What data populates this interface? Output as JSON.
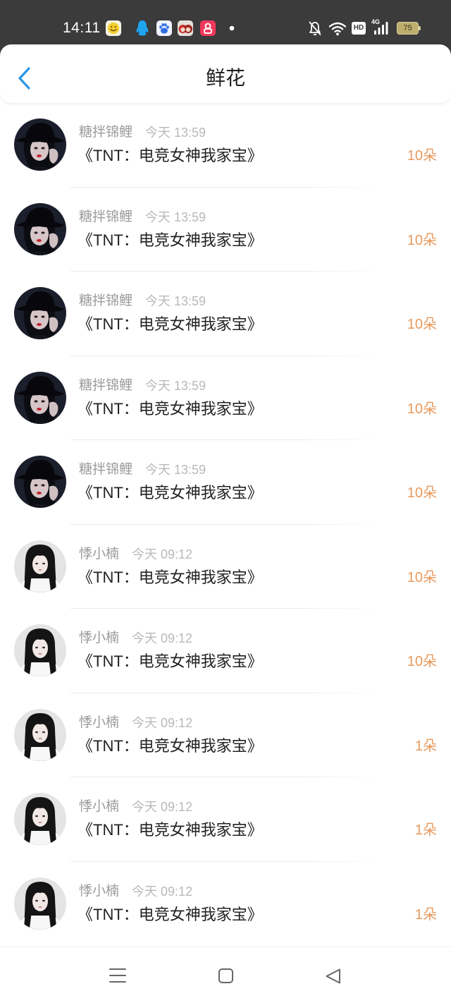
{
  "status_bar": {
    "time": "14:11",
    "hd_label": "HD",
    "network_type": "4G",
    "battery_level": "75",
    "app_icons": [
      "smiley-chat-app-icon",
      "qq-icon",
      "baidu-icon",
      "anime-app-icon",
      "video-app-icon",
      "more-dot-icon"
    ],
    "system_icons": [
      "bell-muted-icon",
      "wifi-icon",
      "hd-icon",
      "signal-icon",
      "battery-icon"
    ]
  },
  "header": {
    "title": "鲜花",
    "back_icon": "chevron-left-icon"
  },
  "flowers": [
    {
      "user": "糖拌锦鲤",
      "time": "今天 13:59",
      "book": "《TNT：电竞女神我家宝》",
      "count": "10朵"
    },
    {
      "user": "糖拌锦鲤",
      "time": "今天 13:59",
      "book": "《TNT：电竞女神我家宝》",
      "count": "10朵"
    },
    {
      "user": "糖拌锦鲤",
      "time": "今天 13:59",
      "book": "《TNT：电竞女神我家宝》",
      "count": "10朵"
    },
    {
      "user": "糖拌锦鲤",
      "time": "今天 13:59",
      "book": "《TNT：电竞女神我家宝》",
      "count": "10朵"
    },
    {
      "user": "糖拌锦鲤",
      "time": "今天 13:59",
      "book": "《TNT：电竞女神我家宝》",
      "count": "10朵"
    },
    {
      "user": "悸小楠",
      "time": "今天 09:12",
      "book": "《TNT：电竞女神我家宝》",
      "count": "10朵"
    },
    {
      "user": "悸小楠",
      "time": "今天 09:12",
      "book": "《TNT：电竞女神我家宝》",
      "count": "10朵"
    },
    {
      "user": "悸小楠",
      "time": "今天 09:12",
      "book": "《TNT：电竞女神我家宝》",
      "count": "1朵"
    },
    {
      "user": "悸小楠",
      "time": "今天 09:12",
      "book": "《TNT：电竞女神我家宝》",
      "count": "1朵"
    },
    {
      "user": "悸小楠",
      "time": "今天 09:12",
      "book": "《TNT：电竞女神我家宝》",
      "count": "1朵"
    }
  ],
  "nav_bar": {
    "icons": [
      "menu-icon",
      "home-square-icon",
      "back-triangle-icon"
    ]
  },
  "colors": {
    "accent": "#2b96e8",
    "count": "#e89a5e",
    "status_bar": "#3b3b3b"
  }
}
